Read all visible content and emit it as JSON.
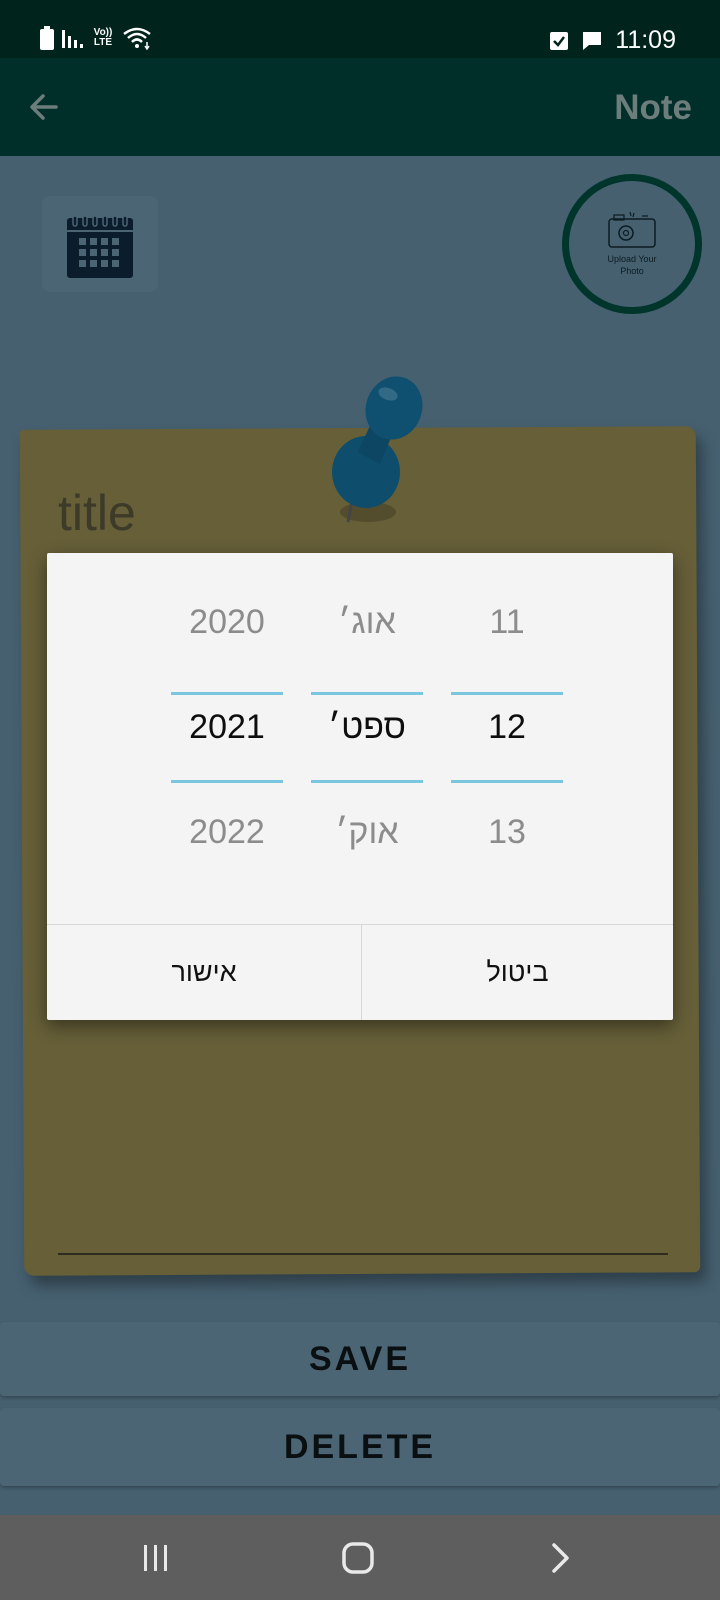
{
  "status_bar": {
    "time": "11:09",
    "network_label": "Vo)) LTE",
    "icons": [
      "battery-icon",
      "signal-icon",
      "wifi-icon",
      "checkbox-notification-icon",
      "message-notification-icon"
    ]
  },
  "app_bar": {
    "back_icon": "arrow-left-icon",
    "title": "Note"
  },
  "content": {
    "calendar_icon": "calendar-icon",
    "photo_button_text": "Upload Your Photo",
    "note_title_placeholder": "title",
    "save_label": "SAVE",
    "delete_label": "DELETE"
  },
  "date_picker": {
    "year": {
      "prev": "2020",
      "selected": "2021",
      "next": "2022"
    },
    "month": {
      "prev": "אוג׳",
      "selected": "ספט׳",
      "next": "אוק׳"
    },
    "day": {
      "prev": "11",
      "selected": "12",
      "next": "13"
    },
    "ok_label": "אישור",
    "cancel_label": "ביטול",
    "accent_color": "#7ac6de"
  },
  "nav_bar": {
    "recents_icon": "recent-apps-icon",
    "home_icon": "home-icon",
    "back_icon": "chevron-right-icon"
  }
}
